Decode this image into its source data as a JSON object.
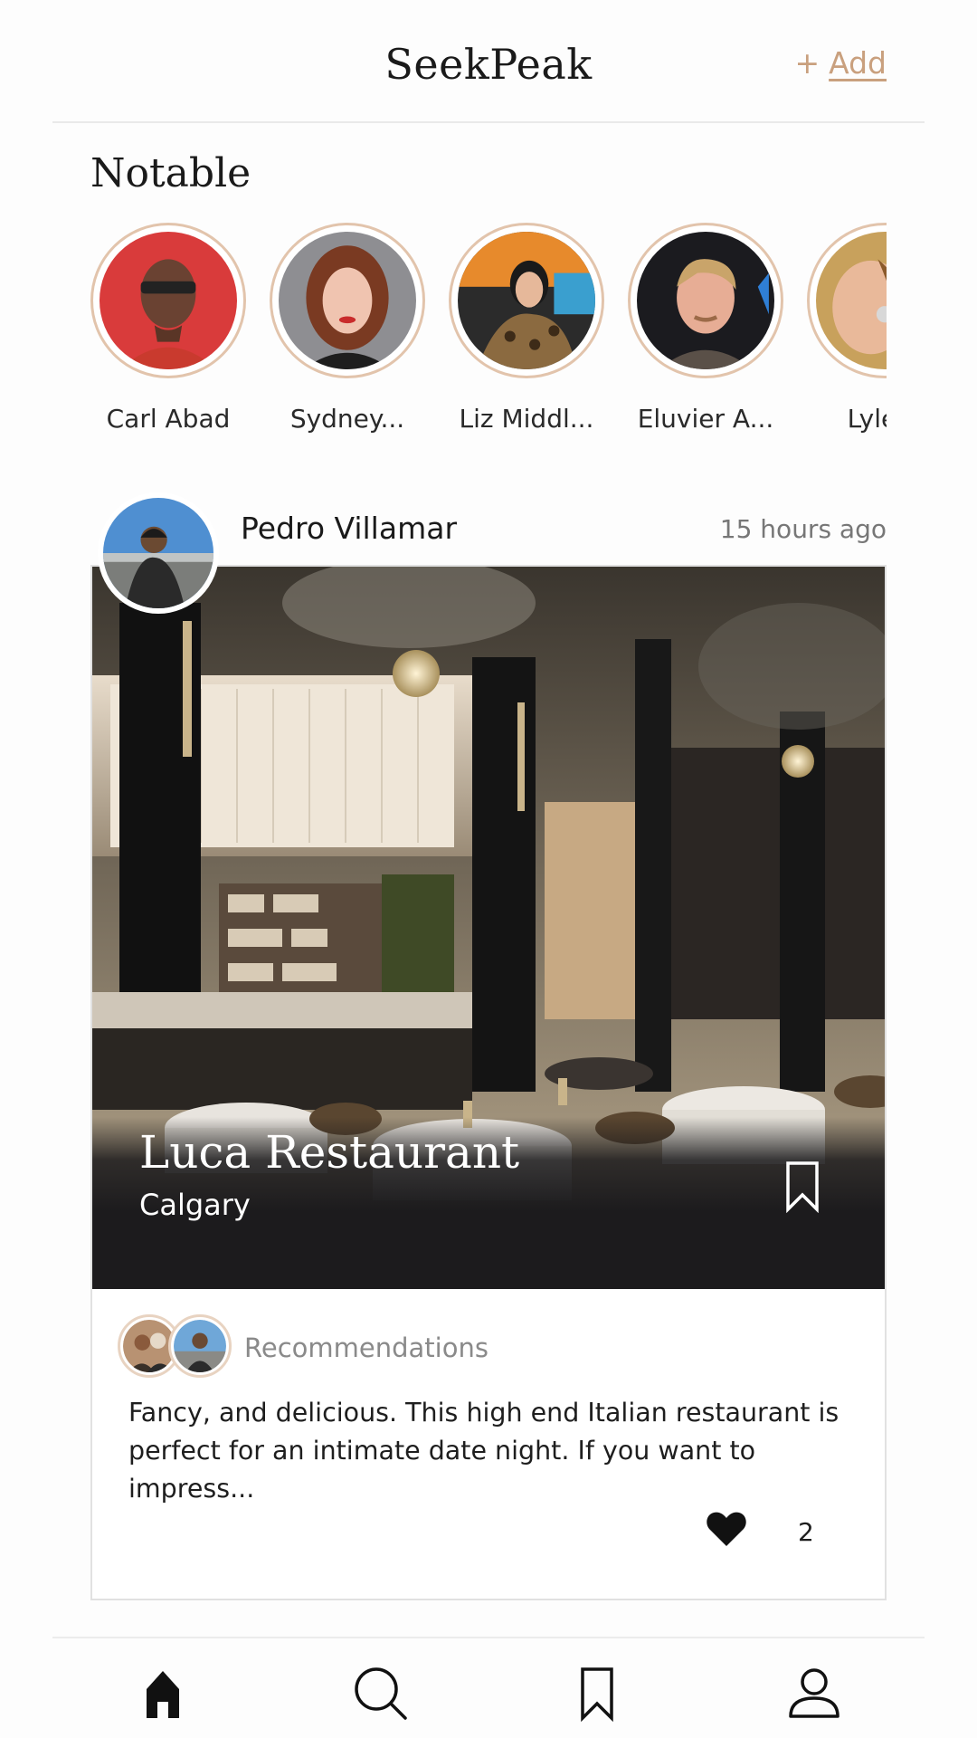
{
  "header": {
    "title": "SeekPeak",
    "add_icon": "plus-icon",
    "add_label": "Add",
    "accent_color": "#c9a07e"
  },
  "notable": {
    "title": "Notable",
    "people": [
      {
        "name": "Carl Abad",
        "avatar": "avatar-photo"
      },
      {
        "name": "Sydney...",
        "avatar": "avatar-photo"
      },
      {
        "name": "Liz Middl...",
        "avatar": "avatar-photo"
      },
      {
        "name": "Eluvier A...",
        "avatar": "avatar-photo"
      },
      {
        "name": "Lyle X",
        "avatar": "avatar-photo"
      }
    ]
  },
  "post": {
    "author": "Pedro Villamar",
    "time": "15 hours ago",
    "place_name": "Luca Restaurant",
    "place_city": "Calgary",
    "bookmark_icon": "bookmark-icon",
    "recommendations_label": "Recommendations",
    "description": "Fancy, and delicious. This high end Italian restaurant is perfect for an intimate date night. If you want to impress...",
    "like_icon": "heart-icon",
    "like_count": "2"
  },
  "bottom_nav": {
    "items": [
      {
        "name": "home",
        "icon": "home-icon",
        "active": true
      },
      {
        "name": "search",
        "icon": "search-icon",
        "active": false
      },
      {
        "name": "saved",
        "icon": "bookmark-icon",
        "active": false
      },
      {
        "name": "profile",
        "icon": "user-icon",
        "active": false
      }
    ]
  }
}
